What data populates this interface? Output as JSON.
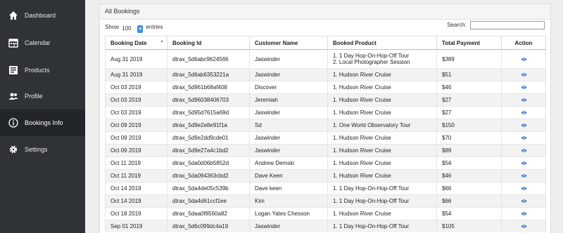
{
  "sidebar": {
    "items": [
      {
        "label": "Dashboard",
        "icon": "home-icon",
        "active": false
      },
      {
        "label": "Calendar",
        "icon": "calendar-icon",
        "active": false
      },
      {
        "label": "Products",
        "icon": "products-icon",
        "active": false
      },
      {
        "label": "Profile",
        "icon": "users-icon",
        "active": false
      },
      {
        "label": "Bookings Info",
        "icon": "info-icon",
        "active": true
      },
      {
        "label": "Settings",
        "icon": "gear-icon",
        "active": false
      }
    ]
  },
  "panel": {
    "title": "All Bookings",
    "show_label": "Show",
    "entries_value": "100",
    "entries_label": "entries",
    "search_label": "Search:",
    "search_value": ""
  },
  "table": {
    "headers": [
      "Booking Date",
      "Booking Id",
      "Customer Name",
      "Booked Product",
      "Total Payment",
      "Action"
    ],
    "rows": [
      {
        "date": "Aug 31 2019",
        "id": "dtrax_5d6abc9624566",
        "customer": "Jaswinder",
        "products": [
          "1. 1 Day Hop-On-Hop-Off Tour",
          "2. Local Photographer Session"
        ],
        "payment": "$389"
      },
      {
        "date": "Aug 31 2019",
        "id": "dtrax_5d6ab6353221a",
        "customer": "Jaswinder",
        "products": [
          "1. Hudson River Cruise"
        ],
        "payment": "$51"
      },
      {
        "date": "Oct 03 2019",
        "id": "dtrax_5d961b68af408",
        "customer": "Discover",
        "products": [
          "1. Hudson River Cruise"
        ],
        "payment": "$46"
      },
      {
        "date": "Oct 03 2019",
        "id": "dtrax_5d96038406703",
        "customer": "Jeremiah",
        "products": [
          "1. Hudson River Cruise"
        ],
        "payment": "$27"
      },
      {
        "date": "Oct 03 2019",
        "id": "dtrax_5d95d7615a69d",
        "customer": "Jaswinder",
        "products": [
          "1. Hudson River Cruise"
        ],
        "payment": "$27"
      },
      {
        "date": "Oct 09 2019",
        "id": "dtrax_5d9e2e8e91f1a",
        "customer": "Sd",
        "products": [
          "1. One World Observatory Tour"
        ],
        "payment": "$150"
      },
      {
        "date": "Oct 09 2019",
        "id": "dtrax_5d9e2dd9cde01",
        "customer": "Jaswinder",
        "products": [
          "1. Hudson River Cruise"
        ],
        "payment": "$70"
      },
      {
        "date": "Oct 09 2019",
        "id": "dtrax_5d9e27a4c1bd2",
        "customer": "Jaswinder",
        "products": [
          "1. Hudson River Cruise"
        ],
        "payment": "$89"
      },
      {
        "date": "Oct 11 2019",
        "id": "dtrax_5da0d06b5852d",
        "customer": "Andrew Demski",
        "products": [
          "1. Hudson River Cruise"
        ],
        "payment": "$54"
      },
      {
        "date": "Oct 11 2019",
        "id": "dtrax_5da094363cbd2",
        "customer": "Dave Keen",
        "products": [
          "1. Hudson River Cruise"
        ],
        "payment": "$46"
      },
      {
        "date": "Oct 14 2019",
        "id": "dtrax_5da4de05c539b",
        "customer": "Dave keen",
        "products": [
          "1. 1 Day Hop-On-Hop-Off Tour"
        ],
        "payment": "$66"
      },
      {
        "date": "Oct 14 2019",
        "id": "dtrax_5da4d61ccf1ee",
        "customer": "Kim",
        "products": [
          "1. 1 Day Hop-On-Hop-Off Tour"
        ],
        "payment": "$66"
      },
      {
        "date": "Oct 18 2019",
        "id": "dtrax_5daa0f8560a82",
        "customer": "Logan Yates Chesson",
        "products": [
          "1. Hudson River Cruise"
        ],
        "payment": "$54"
      },
      {
        "date": "Sep 01 2019",
        "id": "dtrax_5d6c099dc4a19",
        "customer": "Jaswinder",
        "products": [
          "1. 1 Day Hop-On-Hop-Off Tour"
        ],
        "payment": "$105"
      }
    ]
  },
  "colors": {
    "sidebar_bg": "#2f3338",
    "sidebar_active": "#22262a",
    "accent": "#2f7ad6"
  }
}
